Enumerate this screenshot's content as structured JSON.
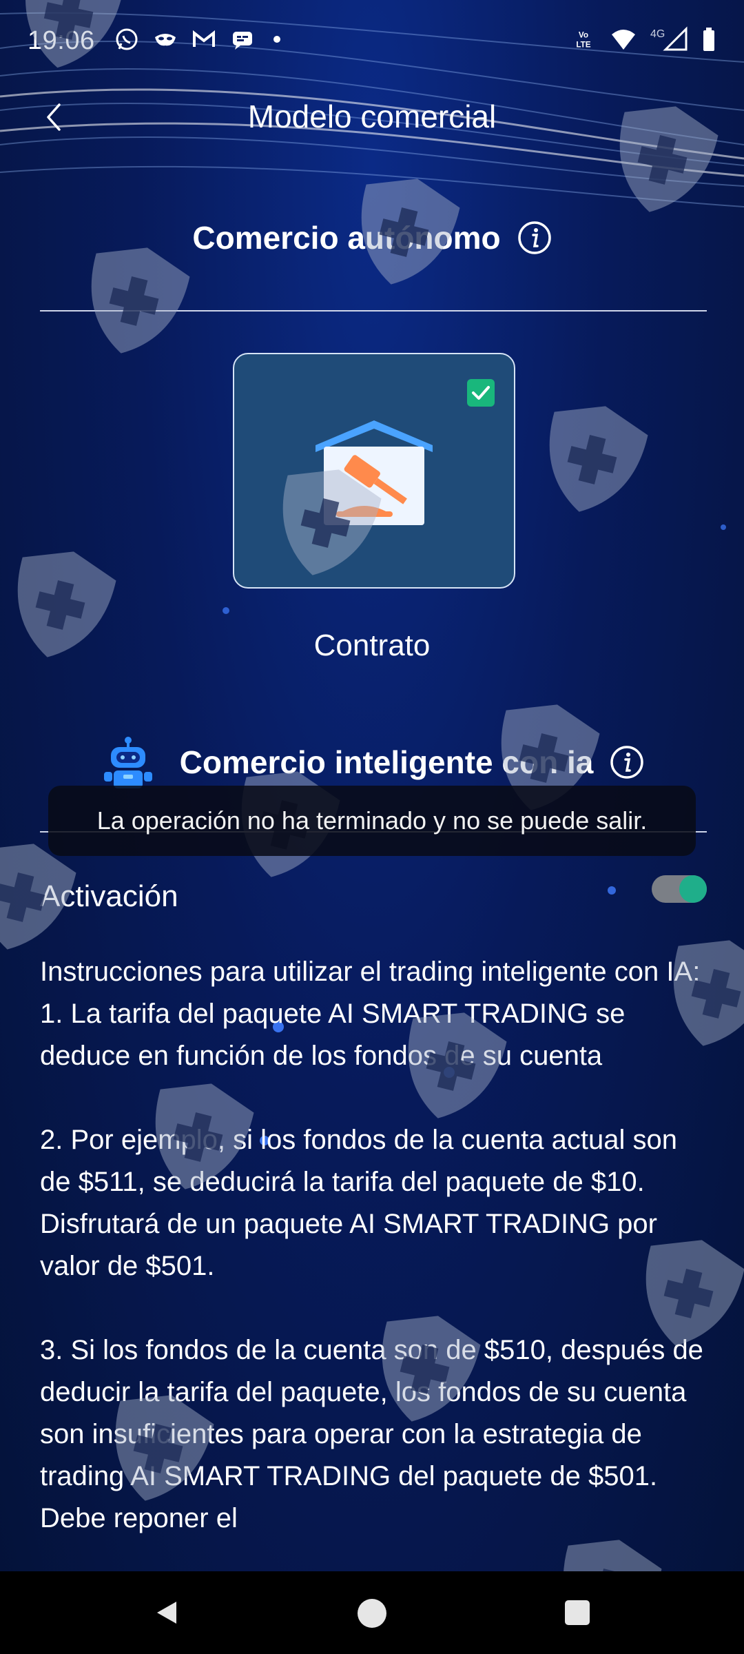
{
  "status_bar": {
    "time": "19:06",
    "left_icons": [
      "whatsapp-icon",
      "mask-icon",
      "gmail-icon",
      "chat-icon"
    ],
    "right_icons": [
      "volte-icon",
      "wifi-icon",
      "signal-icon",
      "battery-icon"
    ],
    "volte_text": "Vo LTE",
    "network_type": "4G"
  },
  "header": {
    "title": "Modelo comercial",
    "back_icon": "chevron-left-icon"
  },
  "autonomous": {
    "title": "Comercio autónomo",
    "card_label": "Contrato",
    "card_selected": true
  },
  "ai": {
    "title": "Comercio inteligente con ia",
    "activation_label": "Activación",
    "activation_on": true
  },
  "toast": {
    "message": "La operación no ha terminado y no se puede salir."
  },
  "instructions": {
    "heading": "Instrucciones para utilizar el trading inteligente con IA:",
    "item1": "1. La tarifa del paquete AI SMART TRADING se deduce en función de los fondos de su cuenta",
    "item2": "2. Por ejemplo, si los fondos de la cuenta actual son de $511, se deducirá la tarifa del paquete de $10. Disfrutará de un paquete AI SMART TRADING por valor de $501.",
    "item3": "3. Si los fondos de la cuenta son de $510, después de deducir la tarifa del paquete, los fondos de su cuenta son insuficientes para operar con la estrategia de trading AI SMART TRADING del paquete de $501. Debe reponer el"
  },
  "nav": {
    "back": "nav-back-icon",
    "home": "nav-home-icon",
    "recent": "nav-recent-icon"
  },
  "colors": {
    "background": "#071a5a",
    "card": "#1f4b78",
    "toggle_on": "#1fae8a",
    "check": "#19b77c"
  }
}
